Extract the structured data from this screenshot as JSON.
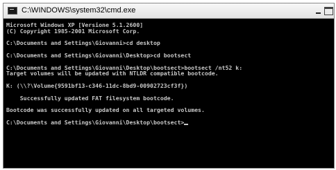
{
  "window": {
    "title": "C:\\WINDOWS\\system32\\cmd.exe",
    "icon": "console-app-icon",
    "controls": [
      "minimize-icon",
      "maximize-icon"
    ]
  },
  "console": {
    "background": "#000000",
    "text_color": "#c8c8c8",
    "lines": [
      "Microsoft Windows XP [Versione 5.1.2600]",
      "(C) Copyright 1985-2001 Microsoft Corp.",
      "",
      "C:\\Documents and Settings\\Giovanni>cd desktop",
      "",
      "C:\\Documents and Settings\\Giovanni\\Desktop>cd bootsect",
      "",
      "C:\\Documents and Settings\\Giovanni\\Desktop\\bootsect>bootsect /nt52 k:",
      "Target volumes will be updated with NTLDR compatible bootcode.",
      "",
      "K: (\\\\?\\Volume{9591bf13-c346-11dc-8bd9-00902723cf3f})",
      "",
      "    Successfully updated FAT filesystem bootcode.",
      "",
      "Bootcode was successfully updated on all targeted volumes.",
      "",
      "C:\\Documents and Settings\\Giovanni\\Desktop\\bootsect>"
    ]
  }
}
